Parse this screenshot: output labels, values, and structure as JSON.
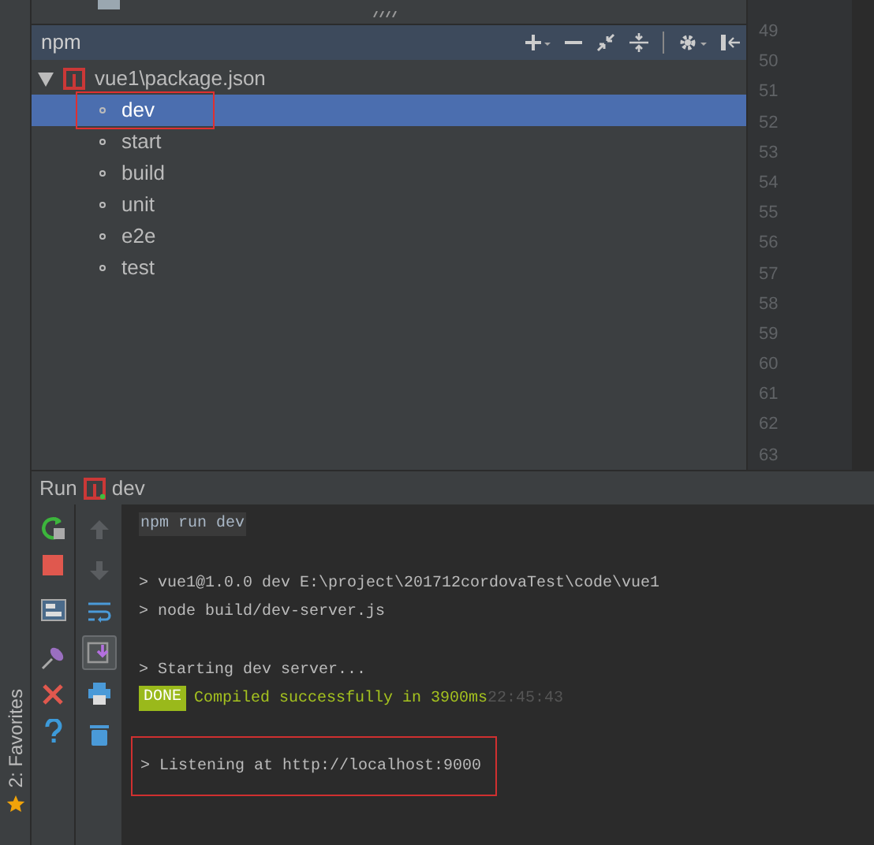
{
  "npm_panel": {
    "title": "npm",
    "tree": {
      "label": "vue1\\package.json",
      "expanded": true,
      "children": [
        {
          "label": "dev",
          "selected": true,
          "highlighted": true
        },
        {
          "label": "start",
          "selected": false,
          "highlighted": false
        },
        {
          "label": "build",
          "selected": false,
          "highlighted": false
        },
        {
          "label": "unit",
          "selected": false,
          "highlighted": false
        },
        {
          "label": "e2e",
          "selected": false,
          "highlighted": false
        },
        {
          "label": "test",
          "selected": false,
          "highlighted": false
        }
      ]
    }
  },
  "gutter": {
    "line_numbers": [
      "49",
      "50",
      "51",
      "52",
      "53",
      "54",
      "55",
      "56",
      "57",
      "58",
      "59",
      "60",
      "61",
      "62",
      "63"
    ]
  },
  "run_panel": {
    "title": "Run",
    "config": "dev",
    "console_toolbar": [
      {
        "kind": "up",
        "disabled": true,
        "on": false
      },
      {
        "kind": "down",
        "disabled": true,
        "on": false
      },
      {
        "kind": "wrap",
        "disabled": false,
        "on": false
      },
      {
        "kind": "scroll-end",
        "disabled": false,
        "on": true
      },
      {
        "kind": "print",
        "disabled": false,
        "on": false
      },
      {
        "kind": "trash",
        "disabled": false,
        "on": false
      }
    ],
    "lines": [
      {
        "kind": "command",
        "text": "npm run dev",
        "highlighted": false
      },
      {
        "kind": "blank"
      },
      {
        "kind": "output",
        "text": "> vue1@1.0.0 dev E:\\project\\201712cordovaTest\\code\\vue1",
        "highlighted": false
      },
      {
        "kind": "output",
        "text": "> node build/dev-server.js",
        "highlighted": false
      },
      {
        "kind": "blank"
      },
      {
        "kind": "output",
        "text": "> Starting dev server...",
        "highlighted": false
      },
      {
        "kind": "status",
        "badge": "DONE",
        "text": "Compiled successfully in 3900ms",
        "time": "22:45:43",
        "highlighted": false
      },
      {
        "kind": "output",
        "text": "> Listening at http://localhost:9000",
        "highlighted": true
      }
    ]
  },
  "side_tab": {
    "label": "2: Favorites"
  }
}
